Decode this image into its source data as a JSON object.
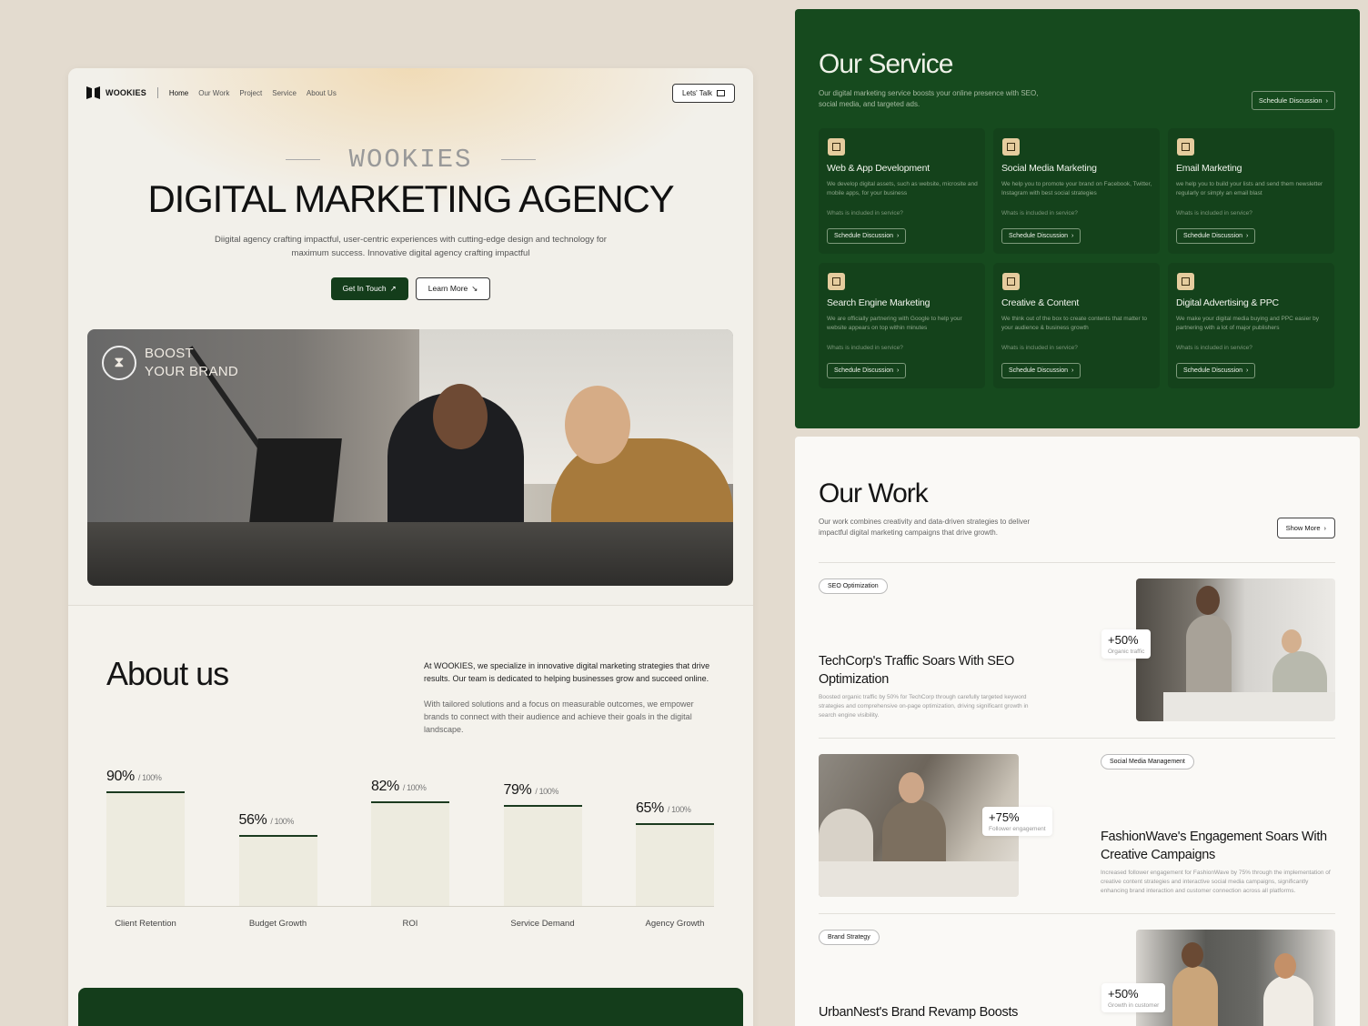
{
  "nav": {
    "logo": "WOOKIES",
    "links": [
      "Home",
      "Our Work",
      "Project",
      "Service",
      "About Us"
    ],
    "cta": "Lets' Talk"
  },
  "hero": {
    "eyebrow": "WOOKIES",
    "title": "DIGITAL MARKETING AGENCY",
    "subtitle": "Diigital agency crafting impactful, user-centric experiences with cutting-edge design and technology for maximum success. Innovative digital agency crafting impactful",
    "primary_btn": "Get In Touch",
    "secondary_btn": "Learn More",
    "photo_caption_1": "BOOST",
    "photo_caption_2": "YOUR BRAND"
  },
  "about": {
    "title": "About us",
    "p1": "At WOOKIES, we specialize in innovative digital marketing strategies that drive results. Our team is dedicated to helping businesses grow and succeed online.",
    "p2": "With tailored solutions and a focus on measurable outcomes, we empower brands to connect with their audience and achieve their goals in the digital landscape."
  },
  "chart_data": {
    "type": "bar",
    "categories": [
      "Client Retention",
      "Budget Growth",
      "ROI",
      "Service Demand",
      "Agency Growth"
    ],
    "values": [
      90,
      56,
      82,
      79,
      65
    ],
    "value_labels": [
      "90%",
      "56%",
      "82%",
      "79%",
      "65%"
    ],
    "max_label": "/ 100%",
    "ylim": [
      0,
      100
    ],
    "grid": false
  },
  "services": {
    "title": "Our Service",
    "desc": "Our digital marketing service boosts your online presence with SEO, social media, and targeted ads.",
    "cta": "Schedule Discussion",
    "question": "Whats is included in service?",
    "items": [
      {
        "title": "Web & App Development",
        "desc": "We develop digital assets, such as website, microsite and mobile apps, for your business",
        "button": "Schedule Discussion",
        "icon": "copy-icon"
      },
      {
        "title": "Social Media Marketing",
        "desc": "We help you to promote your brand on Facebook, Twitter, Instagram with best social strategies",
        "button": "Schedule Discussion",
        "icon": "copy-icon"
      },
      {
        "title": "Email Marketing",
        "desc": "we help you to build your lists and send them newsletter regularly or simply an email blast",
        "button": "Schedule Discussion",
        "icon": "copy-icon"
      },
      {
        "title": "Search Engine Marketing",
        "desc": "We are officially partnering with Google to help your website appears on top within minutes",
        "button": "Schedule Discussion",
        "icon": "copy-icon"
      },
      {
        "title": "Creative & Content",
        "desc": "We think out of the box to create contents that matter to your audience & business growth",
        "button": "Schedule Discussion",
        "icon": "copy-icon"
      },
      {
        "title": "Digital Advertising & PPC",
        "desc": "We make your digital media buying and PPC easier by partnering with a lot of major publishers",
        "button": "Schedule Discussion",
        "icon": "copy-icon"
      }
    ]
  },
  "work": {
    "title": "Our Work",
    "desc": "Our work combines creativity and data-driven strategies to deliver impactful digital marketing campaigns that drive growth.",
    "cta": "Show More",
    "cases": [
      {
        "tag": "SEO Optimization",
        "title": "TechCorp's Traffic Soars With SEO Optimization",
        "desc": "Boosted organic traffic by 50% for TechCorp through carefully targeted keyword strategies and comprehensive on-page optimization, driving significant growth in search engine visibility.",
        "stat": "+50%",
        "stat_label": "Organic traffic"
      },
      {
        "tag": "Social Media Management",
        "title": "FashionWave's Engagement Soars With Creative Campaigns",
        "desc": "Increased follower engagement for FashionWave by 75% through the implementation of creative content strategies and interactive social media campaigns, significantly enhancing brand interaction and customer connection across all platforms.",
        "stat": "+75%",
        "stat_label": "Follower engagement"
      },
      {
        "tag": "Brand Strategy",
        "title": "UrbanNest's Brand Revamp Boosts",
        "desc": "",
        "stat": "+50%",
        "stat_label": "Growth in customer"
      }
    ]
  },
  "colors": {
    "brand_green": "#164a1e",
    "dark_green": "#143d1b",
    "accent_tan": "#e5cc9e",
    "background": "#e3dbcf"
  }
}
